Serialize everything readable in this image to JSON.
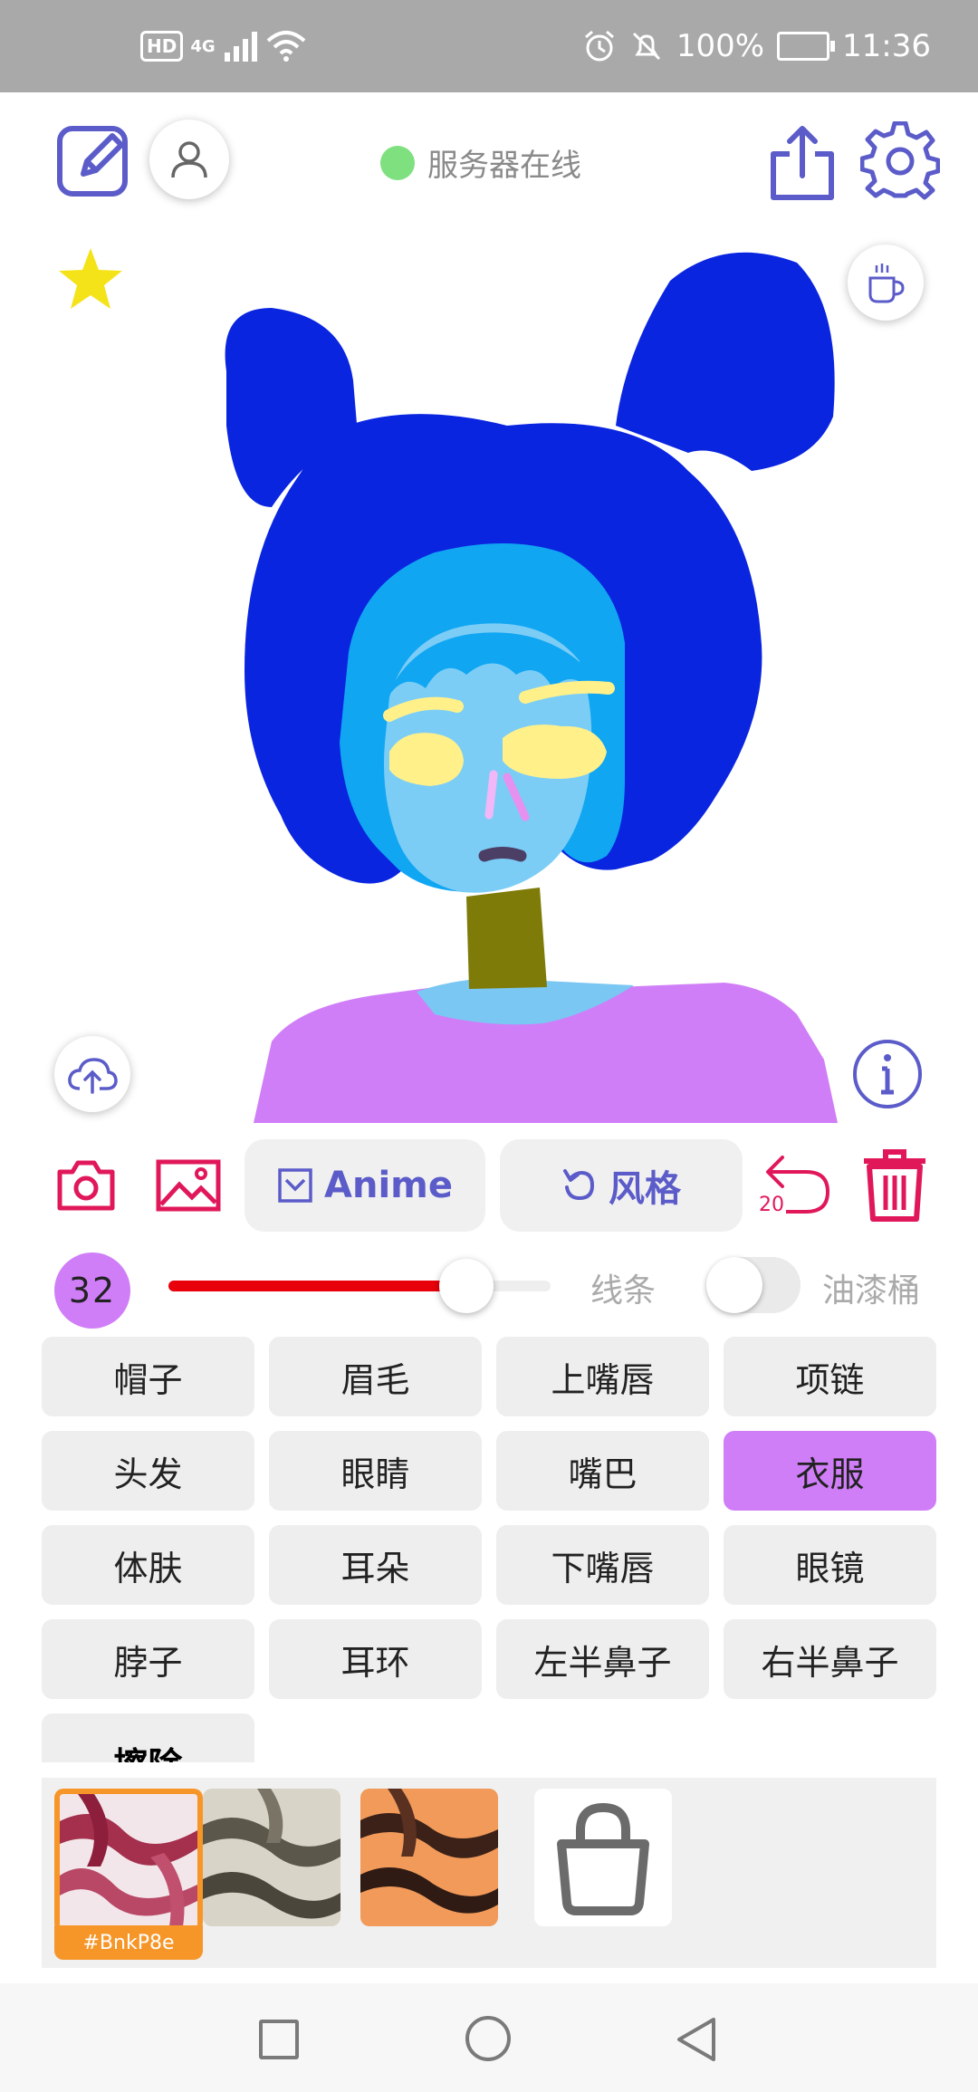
{
  "status_bar": {
    "hd": "HD",
    "network": "4G",
    "battery": "100%",
    "time": "11:36"
  },
  "top_bar": {
    "server_status": "服务器在线",
    "server_status_color": "#7ee07e"
  },
  "toolbar": {
    "model_label": "Anime",
    "style_label": "风格",
    "undo_count": "20"
  },
  "brush": {
    "size": "32",
    "level": 0.78,
    "line_label": "线条",
    "bucket_label": "油漆桶",
    "bucket_enabled": false
  },
  "parts": [
    {
      "label": "帽子",
      "active": false
    },
    {
      "label": "眉毛",
      "active": false
    },
    {
      "label": "上嘴唇",
      "active": false
    },
    {
      "label": "项链",
      "active": false
    },
    {
      "label": "头发",
      "active": false
    },
    {
      "label": "眼睛",
      "active": false
    },
    {
      "label": "嘴巴",
      "active": false
    },
    {
      "label": "衣服",
      "active": true
    },
    {
      "label": "体肤",
      "active": false
    },
    {
      "label": "耳朵",
      "active": false
    },
    {
      "label": "下嘴唇",
      "active": false
    },
    {
      "label": "眼镜",
      "active": false
    },
    {
      "label": "脖子",
      "active": false
    },
    {
      "label": "耳环",
      "active": false
    },
    {
      "label": "左半鼻子",
      "active": false
    },
    {
      "label": "右半鼻子",
      "active": false
    }
  ],
  "erase_label": "擦除",
  "styles": {
    "selected_tag": "#BnkP8e",
    "icons": [
      "style-tile-pink",
      "style-tile-gray",
      "style-tile-orange",
      "lock-icon"
    ]
  },
  "colors": {
    "accent": "#5b5cc9",
    "danger": "#e0185a",
    "selected_part": "#d07ef7",
    "slider": "#e8000a",
    "style_selected": "#f79628"
  }
}
